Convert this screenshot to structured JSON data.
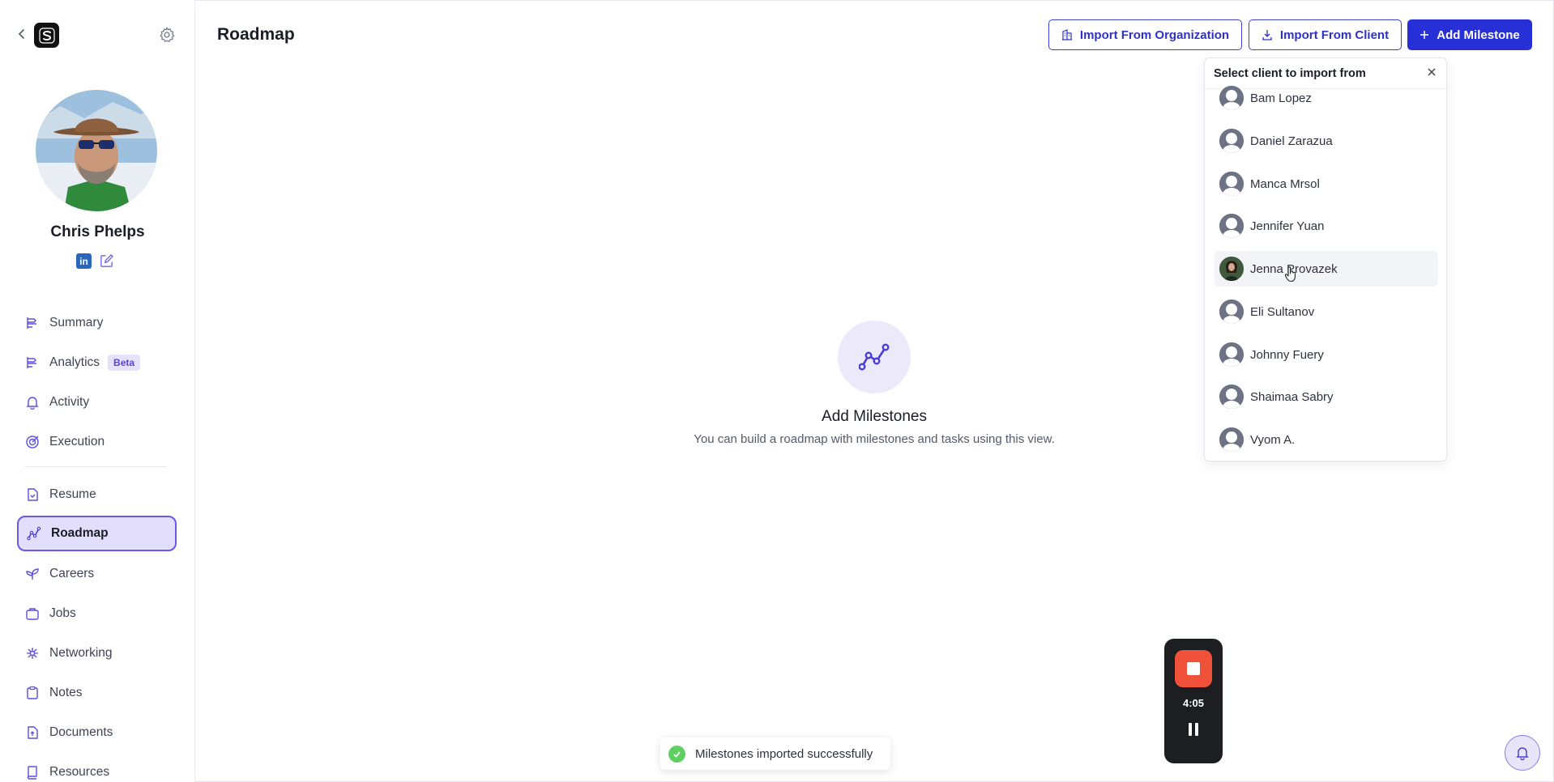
{
  "header": {
    "title": "Roadmap"
  },
  "profile": {
    "name": "Chris Phelps"
  },
  "sidebar": {
    "items": [
      {
        "label": "Summary",
        "icon": "summary-icon"
      },
      {
        "label": "Analytics",
        "icon": "analytics-icon",
        "badge": "Beta"
      },
      {
        "label": "Activity",
        "icon": "bell-icon"
      },
      {
        "label": "Execution",
        "icon": "target-icon"
      },
      {
        "label": "Resume",
        "icon": "resume-icon"
      },
      {
        "label": "Roadmap",
        "icon": "roadmap-icon",
        "active": true
      },
      {
        "label": "Careers",
        "icon": "sprout-icon"
      },
      {
        "label": "Jobs",
        "icon": "briefcase-icon"
      },
      {
        "label": "Networking",
        "icon": "network-icon"
      },
      {
        "label": "Notes",
        "icon": "clipboard-icon"
      },
      {
        "label": "Documents",
        "icon": "document-icon"
      },
      {
        "label": "Resources",
        "icon": "book-icon"
      }
    ]
  },
  "toolbar": {
    "import_org_label": "Import From Organization",
    "import_client_label": "Import From Client",
    "add_milestone_label": "Add Milestone"
  },
  "empty_state": {
    "title": "Add Milestones",
    "subtitle": "You can build a roadmap with milestones and tasks using this view."
  },
  "client_dropdown": {
    "title": "Select client to import from",
    "clients": [
      "Bam Lopez",
      "Daniel Zarazua",
      "Manca Mrsol",
      "Jennifer Yuan",
      "Jenna Provazek",
      "Eli Sultanov",
      "Johnny Fuery",
      "Shaimaa Sabry",
      "Vyom A."
    ]
  },
  "toast": {
    "message": "Milestones imported successfully"
  },
  "recorder": {
    "time": "4:05"
  },
  "colors": {
    "accent": "#2730d6",
    "active_bg": "#e3defc",
    "record": "#ef5238",
    "success": "#5fcf62"
  }
}
